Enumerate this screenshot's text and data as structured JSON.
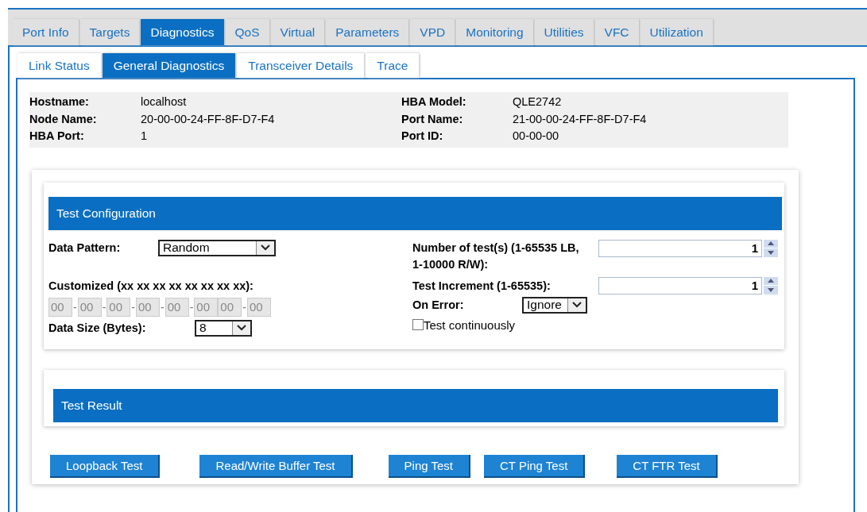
{
  "tabs": [
    {
      "label": "Port Info",
      "selected": false
    },
    {
      "label": "Targets",
      "selected": false
    },
    {
      "label": "Diagnostics",
      "selected": true
    },
    {
      "label": "QoS",
      "selected": false
    },
    {
      "label": "Virtual",
      "selected": false
    },
    {
      "label": "Parameters",
      "selected": false
    },
    {
      "label": "VPD",
      "selected": false
    },
    {
      "label": "Monitoring",
      "selected": false
    },
    {
      "label": "Utilities",
      "selected": false
    },
    {
      "label": "VFC",
      "selected": false
    },
    {
      "label": "Utilization",
      "selected": false
    }
  ],
  "subtabs": [
    {
      "label": "Link Status",
      "selected": false
    },
    {
      "label": "General Diagnostics",
      "selected": true
    },
    {
      "label": "Transceiver Details",
      "selected": false
    },
    {
      "label": "Trace",
      "selected": false
    }
  ],
  "info": {
    "left": [
      {
        "label": "Hostname:",
        "value": "localhost"
      },
      {
        "label": "Node Name:",
        "value": "20-00-00-24-FF-8F-D7-F4"
      },
      {
        "label": "HBA Port:",
        "value": "1"
      }
    ],
    "right": [
      {
        "label": "HBA Model:",
        "value": "QLE2742"
      },
      {
        "label": "Port Name:",
        "value": "21-00-00-24-FF-8F-D7-F4"
      },
      {
        "label": "Port ID:",
        "value": "00-00-00"
      }
    ]
  },
  "test_configuration": {
    "title": "Test Configuration",
    "data_pattern": {
      "label": "Data Pattern:",
      "value": "Random"
    },
    "customized": {
      "label": "Customized (xx xx xx xx xx xx xx xx):",
      "fields": [
        {
          "value": "00",
          "disabled": true
        },
        {
          "prefix": "-",
          "value": "00",
          "disabled": true
        },
        {
          "prefix": "-",
          "value": "00",
          "disabled": true
        },
        {
          "prefix": "-",
          "value": "00",
          "disabled": true
        },
        {
          "prefix": "-",
          "value": "00",
          "disabled": true
        },
        {
          "prefix": "-",
          "value": "00",
          "disabled": true
        },
        {
          "value": "00",
          "disabled": true
        },
        {
          "prefix": "-",
          "value": "00",
          "disabled": true
        }
      ]
    },
    "data_size": {
      "label": "Data Size (Bytes):",
      "value": "8"
    },
    "number_of_tests": {
      "label": "Number of test(s) (1-65535 LB, 1-10000 R/W):",
      "value": "1"
    },
    "test_increment": {
      "label": "Test Increment (1-65535):",
      "value": "1"
    },
    "on_error": {
      "label": "On Error:",
      "value": "Ignore"
    },
    "test_continuously": {
      "label": "Test continuously",
      "checked": false
    }
  },
  "test_result": {
    "title": "Test Result"
  },
  "buttons": [
    "Loopback Test",
    "Read/Write Buffer Test",
    "Ping Test",
    "CT Ping Test",
    "CT FTR Test"
  ]
}
